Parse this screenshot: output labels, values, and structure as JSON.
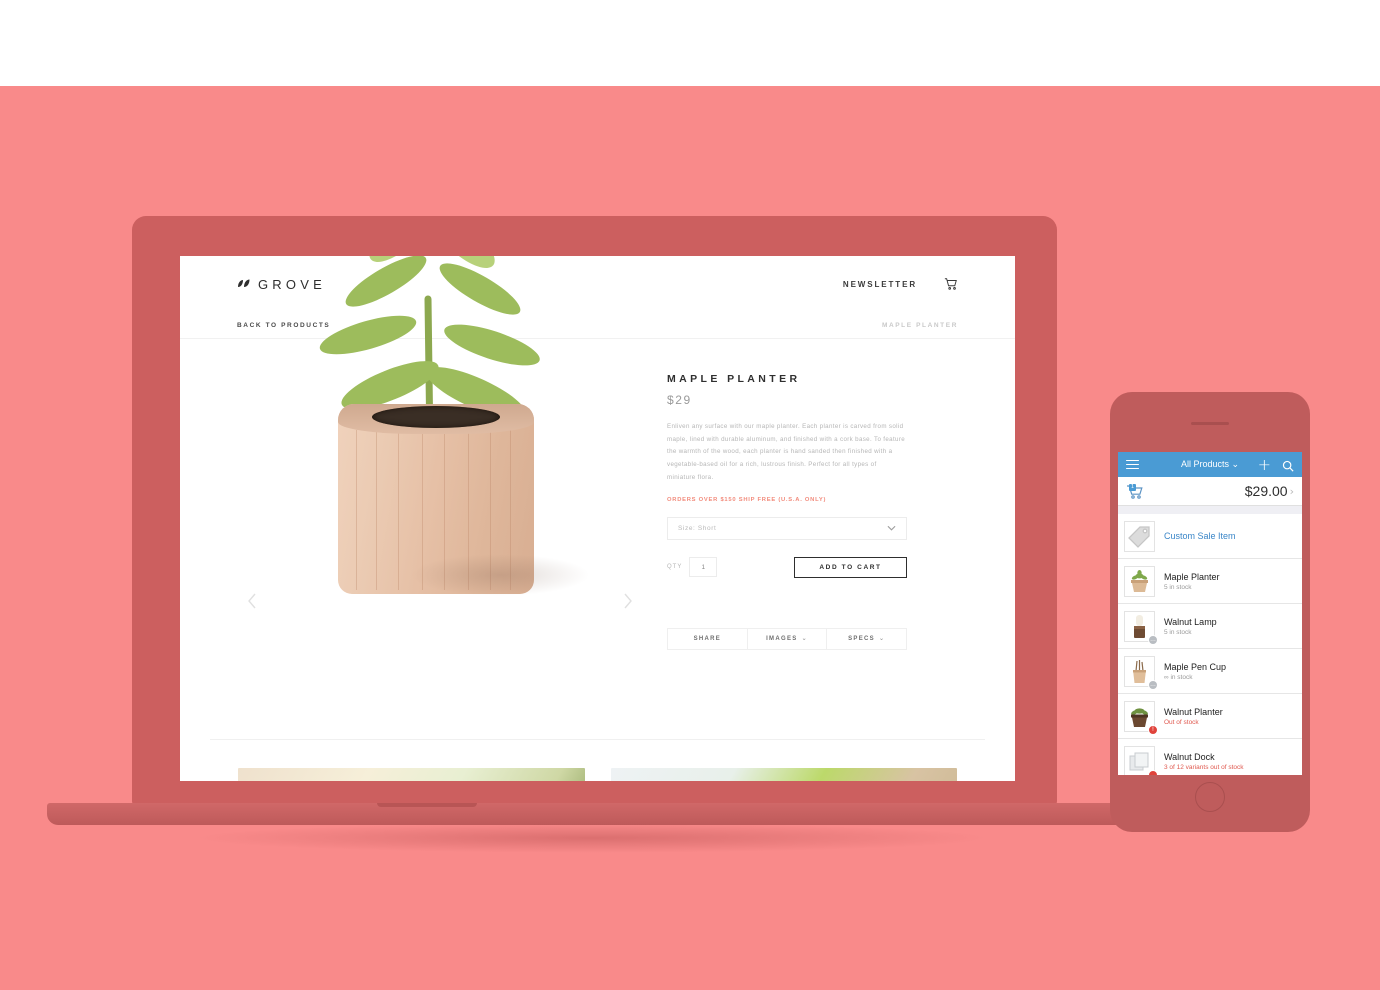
{
  "colors": {
    "backdrop": "#F98A8A",
    "device_frame": "#CC5F5F",
    "phone_frame": "#BF5C5C",
    "phone_nav_blue": "#4A9BD4",
    "accent_coral": "#F28B7C",
    "warning_red": "#E0594F"
  },
  "desktop": {
    "header": {
      "logo_text": "GROVE",
      "logo_icon": "leaf-icon",
      "newsletter_label": "NEWSLETTER",
      "cart_icon": "shopping-cart-icon"
    },
    "breadcrumb": {
      "back_label": "BACK TO PRODUCTS",
      "current_label": "MAPLE PLANTER"
    },
    "gallery": {
      "prev_icon": "chevron-left-icon",
      "next_icon": "chevron-right-icon",
      "image_alt": "maple-planter-product-photo"
    },
    "product": {
      "title": "MAPLE PLANTER",
      "price": "$29",
      "description": "Enliven any surface with our maple planter. Each planter is carved from solid maple, lined with durable aluminum, and finished with a cork base. To feature the warmth of the wood, each planter is hand sanded then finished with a vegetable-based oil for a rich, lustrous finish. Perfect for all types of miniature flora.",
      "shipping_note": "ORDERS OVER $150 SHIP FREE (U.S.A. ONLY)",
      "size_select": {
        "value": "Size: Short",
        "chevron": "chevron-down-icon"
      },
      "qty_label": "QTY",
      "qty_value": "1",
      "add_to_cart_label": "ADD TO CART",
      "tabs": [
        {
          "label": "SHARE",
          "chevron": ""
        },
        {
          "label": "IMAGES",
          "chevron": "⌄"
        },
        {
          "label": "SPECS",
          "chevron": "⌄"
        }
      ]
    },
    "thumbnails": [
      {
        "alt": "lifestyle-photo-succulents"
      },
      {
        "alt": "lifestyle-photo-desk-plant"
      }
    ]
  },
  "phone": {
    "nav": {
      "menu_icon": "hamburger-menu-icon",
      "title": "All Products",
      "title_chevron": "⌄",
      "add_icon": "plus-icon",
      "search_icon": "search-icon"
    },
    "cart_row": {
      "cart_icon": "shopping-cart-icon",
      "badge_count": "1",
      "total": "$29.00",
      "chevron": "›"
    },
    "products": [
      {
        "name": "Custom Sale Item",
        "stock": "",
        "thumb_icon": "price-tag-icon",
        "badge": "",
        "is_link": true,
        "warn": false
      },
      {
        "name": "Maple Planter",
        "stock": "5 in stock",
        "thumb_icon": "maple-planter-thumb",
        "badge": "",
        "is_link": false,
        "warn": false
      },
      {
        "name": "Walnut Lamp",
        "stock": "5 in stock",
        "thumb_icon": "walnut-lamp-thumb",
        "badge": "…",
        "badge_color": "grey",
        "is_link": false,
        "warn": false
      },
      {
        "name": "Maple Pen Cup",
        "stock": "∞ in stock",
        "thumb_icon": "maple-pen-cup-thumb",
        "badge": "…",
        "badge_color": "grey",
        "is_link": false,
        "warn": false
      },
      {
        "name": "Walnut Planter",
        "stock": "Out of stock",
        "thumb_icon": "walnut-planter-thumb",
        "badge": "!",
        "badge_color": "red",
        "is_link": false,
        "warn": true
      },
      {
        "name": "Walnut Dock",
        "stock": "3 of 12 variants out of stock",
        "thumb_icon": "walnut-dock-thumb",
        "badge": "…",
        "badge_color": "red",
        "is_link": false,
        "warn": true
      }
    ]
  }
}
